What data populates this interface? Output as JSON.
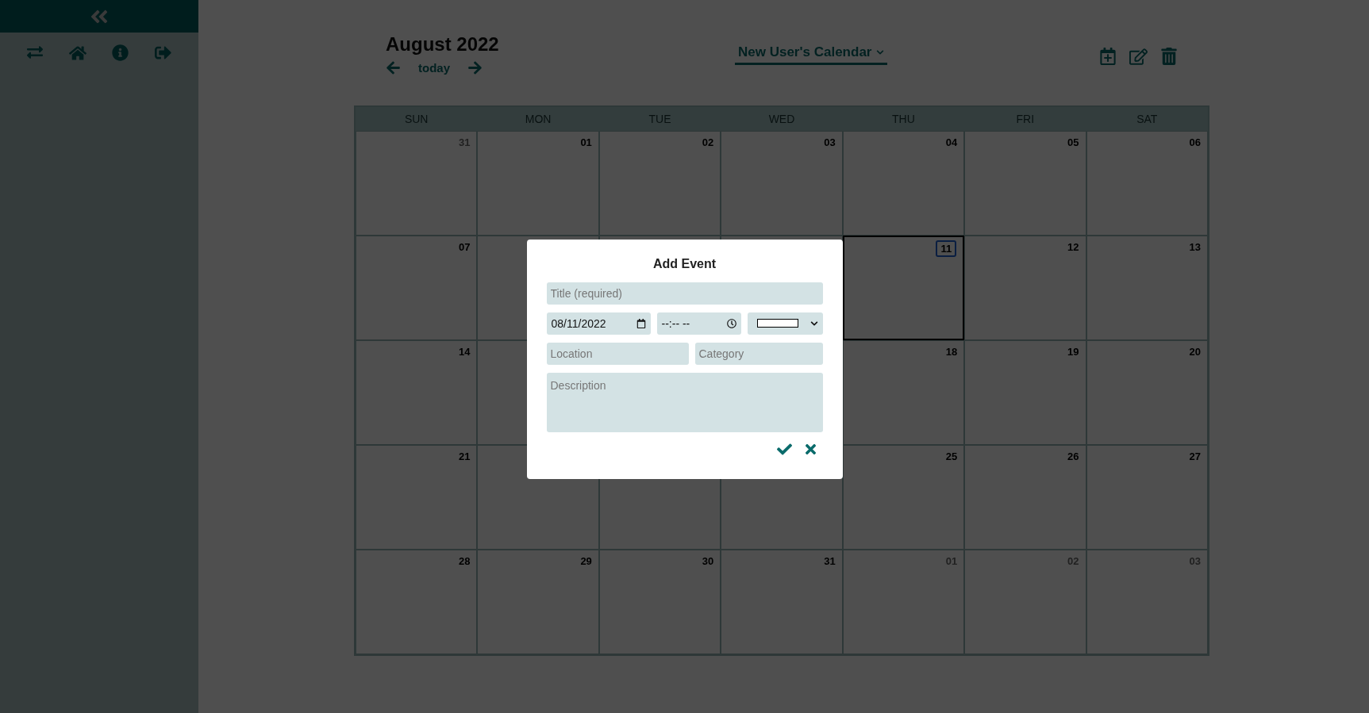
{
  "header": {
    "month_title": "August 2022",
    "today_button": "today",
    "calendar_dropdown": "New User's Calendar"
  },
  "calendar": {
    "weekdays": [
      "SUN",
      "MON",
      "TUE",
      "WED",
      "THU",
      "FRI",
      "SAT"
    ],
    "weeks": [
      {
        "days": [
          {
            "day": "31",
            "outside": true,
            "selected": false
          },
          {
            "day": "01",
            "outside": false,
            "selected": false
          },
          {
            "day": "02",
            "outside": false,
            "selected": false
          },
          {
            "day": "03",
            "outside": false,
            "selected": false
          },
          {
            "day": "04",
            "outside": false,
            "selected": false
          },
          {
            "day": "05",
            "outside": false,
            "selected": false
          },
          {
            "day": "06",
            "outside": false,
            "selected": false
          }
        ]
      },
      {
        "days": [
          {
            "day": "07",
            "outside": false,
            "selected": false
          }
        ],
        "days_after_dialog": [
          {
            "day": "11",
            "outside": false,
            "selected": true
          },
          {
            "day": "12",
            "outside": false,
            "selected": false
          },
          {
            "day": "13",
            "outside": false,
            "selected": false
          }
        ]
      },
      {
        "days": [
          {
            "day": "14",
            "outside": false,
            "selected": false
          }
        ],
        "days_after_dialog": [
          {
            "day": "18",
            "outside": false,
            "selected": false
          },
          {
            "day": "19",
            "outside": false,
            "selected": false
          },
          {
            "day": "20",
            "outside": false,
            "selected": false
          }
        ]
      },
      {
        "days": [
          {
            "day": "21",
            "outside": false,
            "selected": false
          }
        ],
        "days_after_dialog": [
          {
            "day": "25",
            "outside": false,
            "selected": false
          },
          {
            "day": "26",
            "outside": false,
            "selected": false
          },
          {
            "day": "27",
            "outside": false,
            "selected": false
          }
        ]
      },
      {
        "days": [
          {
            "day": "28",
            "outside": false,
            "selected": false
          },
          {
            "day": "29",
            "outside": false,
            "selected": false
          },
          {
            "day": "30",
            "outside": false,
            "selected": false
          },
          {
            "day": "31",
            "outside": false,
            "selected": false
          },
          {
            "day": "01",
            "outside": true,
            "selected": false
          },
          {
            "day": "02",
            "outside": true,
            "selected": false
          },
          {
            "day": "03",
            "outside": true,
            "selected": false
          }
        ]
      }
    ]
  },
  "modal": {
    "title": "Add Event",
    "title_field": {
      "placeholder": "Title (required)"
    },
    "date_field": {
      "value": "08/11/2022"
    },
    "time_field": {
      "value": "--:-- --"
    },
    "color_select": {
      "color": "#ffffff"
    },
    "location_field": {
      "placeholder": "Location"
    },
    "category_field": {
      "placeholder": "Category"
    },
    "description_field": {
      "placeholder": "Description"
    }
  }
}
